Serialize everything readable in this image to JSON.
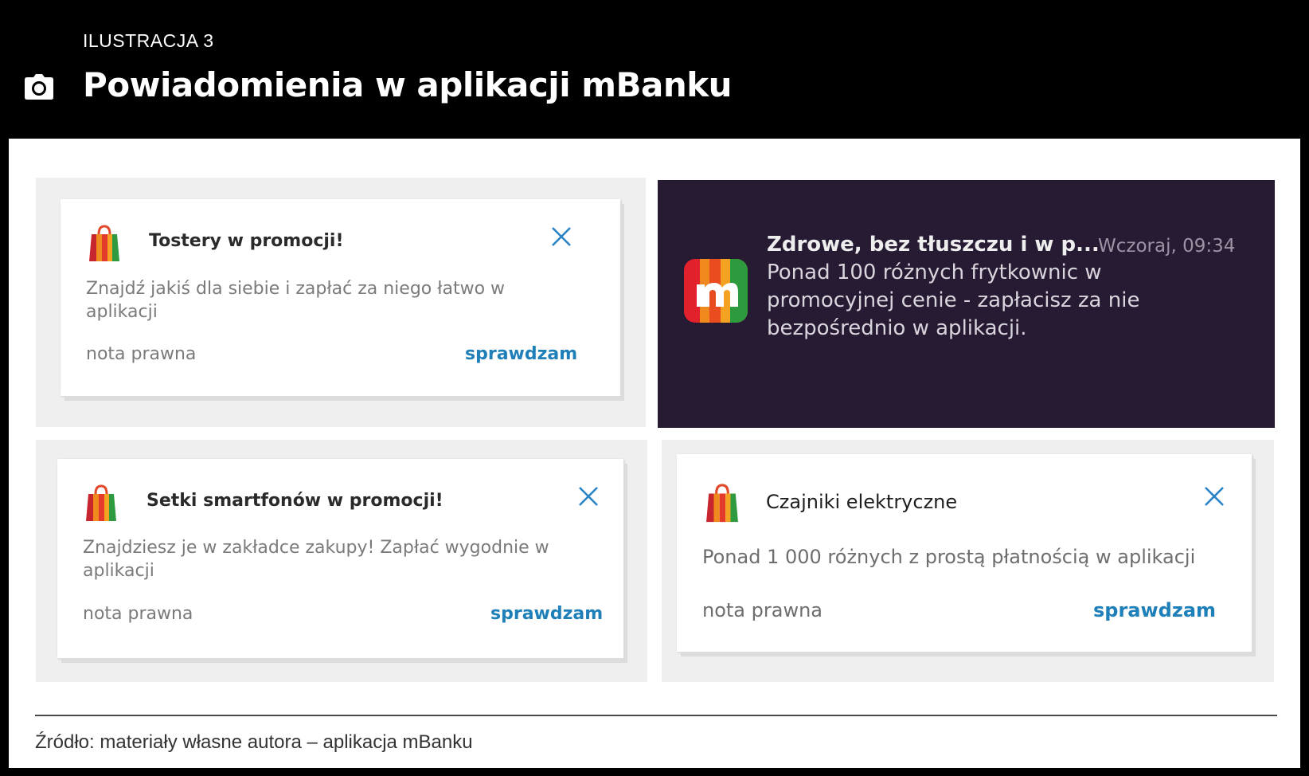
{
  "header": {
    "label": "ILUSTRACJA 3",
    "title": "Powiadomienia w aplikacji mBanku"
  },
  "icons": {
    "camera": "camera-icon",
    "bag": "shopping-bag-icon",
    "close": "close-icon",
    "app": "mbank-app-icon"
  },
  "colors": {
    "header_bg": "#000000",
    "link_blue": "#1f7fb8",
    "dark_notification_bg": "#271a33"
  },
  "notifications": [
    {
      "title": "Tostery w promocji!",
      "body": "Znajdź jakiś dla siebie i zapłać za niego łatwo w aplikacji",
      "legal": "nota prawna",
      "cta": "sprawdzam"
    },
    {
      "title": "Zdrowe, bez tłuszczu i w p...",
      "time": "Wczoraj, 09:34",
      "body": "Ponad 100 różnych frytkownic w promocyjnej cenie - zapłacisz za nie bezpośrednio w aplikacji."
    },
    {
      "title": "Setki smartfonów w promocji!",
      "body": "Znajdziesz je w zakładce zakupy! Zapłać wygodnie w aplikacji",
      "legal": "nota prawna",
      "cta": "sprawdzam"
    },
    {
      "title": "Czajniki elektryczne",
      "body": "Ponad 1 000 różnych z prostą płatnością w aplikacji",
      "legal": "nota prawna",
      "cta": "sprawdzam"
    }
  ],
  "footer": {
    "source": "Źródło: materiały własne autora – aplikacja mBanku"
  }
}
